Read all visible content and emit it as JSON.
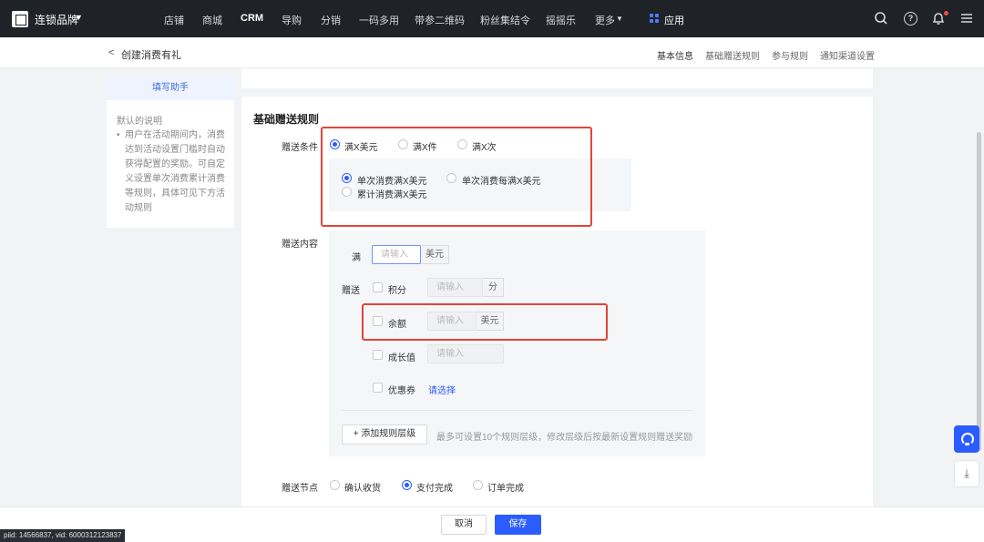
{
  "topnav": {
    "brand": "连锁品牌",
    "items": [
      "店铺",
      "商城",
      "CRM",
      "导购",
      "分销",
      "一码多用",
      "带参二维码",
      "粉丝集结令",
      "摇摇乐",
      "更多"
    ],
    "active": "CRM",
    "app_label": "应用",
    "icons": [
      "search-icon",
      "help-icon",
      "bell-icon",
      "menu-icon"
    ]
  },
  "subheader": {
    "back": "<",
    "title": "创建消费有礼",
    "anchors": [
      "基本信息",
      "基础赠送规则",
      "参与规则",
      "通知渠道设置"
    ]
  },
  "helper": {
    "title": "填写助手",
    "subtitle": "默认的说明",
    "body": "用户在活动期间内，消费达到活动设置门槛时自动获得配置的奖励。可自定义设置单次消费累计消费等规则，具体可见下方活动规则"
  },
  "section": {
    "title": "基础赠送规则"
  },
  "condition": {
    "label": "赠送条件",
    "options": [
      "满X美元",
      "满X件",
      "满X次"
    ],
    "selected": 0,
    "sub_options": [
      "单次消费满X美元",
      "单次消费每满X美元",
      "累计消费满X美元"
    ],
    "sub_selected": 0
  },
  "content": {
    "label": "赠送内容",
    "full_label": "满",
    "full_placeholder": "请输入",
    "full_unit": "美元",
    "gift_label": "赠送",
    "items": [
      {
        "name": "积分",
        "placeholder": "请输入",
        "unit": "分"
      },
      {
        "name": "余额",
        "placeholder": "请输入",
        "unit": "美元"
      },
      {
        "name": "成长值",
        "placeholder": "请输入",
        "unit": ""
      },
      {
        "name": "优惠券",
        "link": "请选择"
      }
    ],
    "add_button": "+ 添加规则层级",
    "hint": "最多可设置10个规则层级，修改层级后按最新设置规则赠送奖励"
  },
  "node": {
    "label": "赠送节点",
    "options": [
      "确认收货",
      "支付完成",
      "订单完成"
    ],
    "selected": 1
  },
  "footer": {
    "cancel": "取消",
    "save": "保存",
    "debug": "piid: 14566837, vid: 6000312123837"
  },
  "colors": {
    "primary": "#2b5cff",
    "highlight": "#e3443a",
    "nav_bg": "#1f2227"
  }
}
